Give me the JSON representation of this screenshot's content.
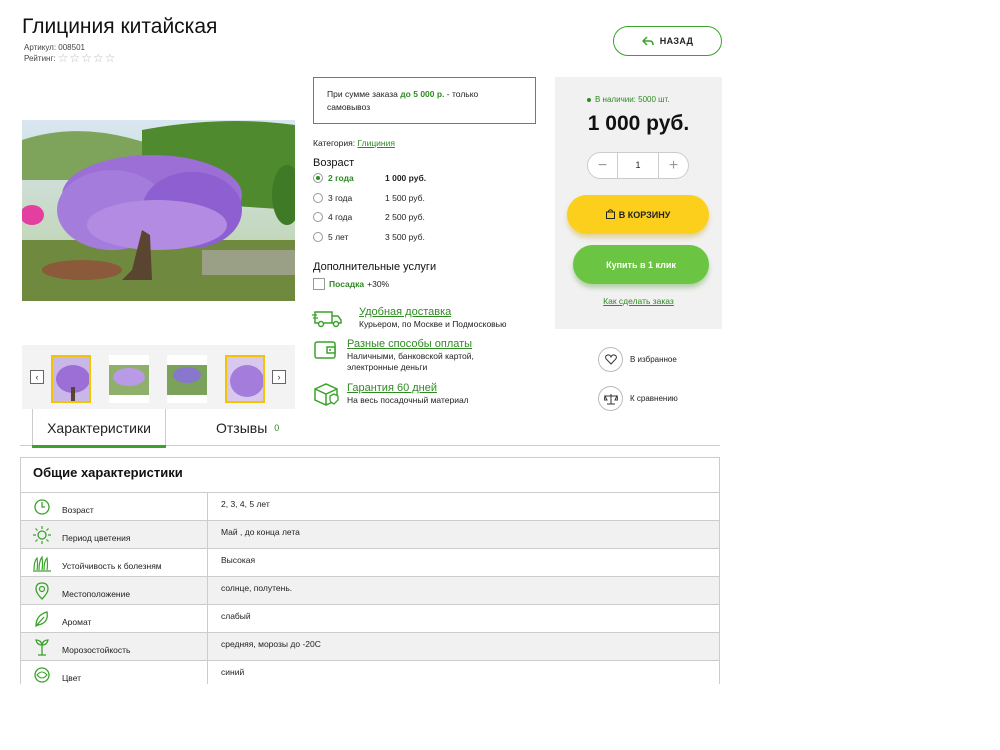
{
  "product": {
    "title": "Глициния китайская",
    "sku": "Артикул: 008501",
    "rating_label": "Рейтинг:"
  },
  "back_label": "НАЗАД",
  "promo": {
    "prefix": "При сумме заказа ",
    "amount": "до 5 000 р.",
    "suffix": " - только самовывоз"
  },
  "category": {
    "label": "Категория:",
    "value": "Глициния"
  },
  "age": {
    "title": "Возраст",
    "options": [
      {
        "label": "2 года",
        "price": "1 000 руб.",
        "selected": true
      },
      {
        "label": "3 года",
        "price": "1 500 руб.",
        "selected": false
      },
      {
        "label": "4 года",
        "price": "2 500 руб.",
        "selected": false
      },
      {
        "label": "5 лет",
        "price": "3 500 руб.",
        "selected": false
      }
    ]
  },
  "extras": {
    "title": "Дополнительные услуги",
    "planting_label": "Посадка",
    "planting_price": "+30%"
  },
  "features": [
    {
      "icon": "delivery-truck-icon",
      "title": "Удобная доставка",
      "desc": "Курьером, по Москве и Подмосковью"
    },
    {
      "icon": "wallet-icon",
      "title": "Разные способы оплаты",
      "desc": "Наличными, банковской картой, электронные деньги"
    },
    {
      "icon": "guarantee-box-icon",
      "title": "Гарантия 60 дней",
      "desc": "На весь посадочный материал"
    }
  ],
  "buybox": {
    "stock": "В наличии: 5000 шт.",
    "price": "1 000 руб.",
    "quantity": "1",
    "minus": "−",
    "plus": "+",
    "cart_label": "В КОРЗИНУ",
    "oneclick_label": "Купить в 1 клик",
    "howto_label": "Как сделать заказ"
  },
  "side_actions": {
    "favorites": "В избранное",
    "compare": "К сравнению"
  },
  "tabs": {
    "characteristics": "Характеристики",
    "reviews": "Отзывы",
    "reviews_count": "0"
  },
  "specs": {
    "title": "Общие характеристики",
    "rows": [
      {
        "key": "Возраст",
        "value": "2, 3, 4, 5 лет"
      },
      {
        "key": "Период цветения",
        "value": "Май , до конца лета"
      },
      {
        "key": "Устойчивость к болезням",
        "value": "Высокая"
      },
      {
        "key": "Местоположение",
        "value": "солнце, полутень."
      },
      {
        "key": "Аромат",
        "value": "слабый"
      },
      {
        "key": "Морозостойкость",
        "value": "средняя, морозы до -20С"
      },
      {
        "key": "Цвет",
        "value": "синий"
      }
    ]
  },
  "colors": {
    "accent_green": "#3aa32a",
    "text_green": "#2e8b22",
    "cart_yellow": "#fbcf1b",
    "oneclick_green": "#6cc443",
    "wisteria_purple": "#9b6fd6"
  }
}
